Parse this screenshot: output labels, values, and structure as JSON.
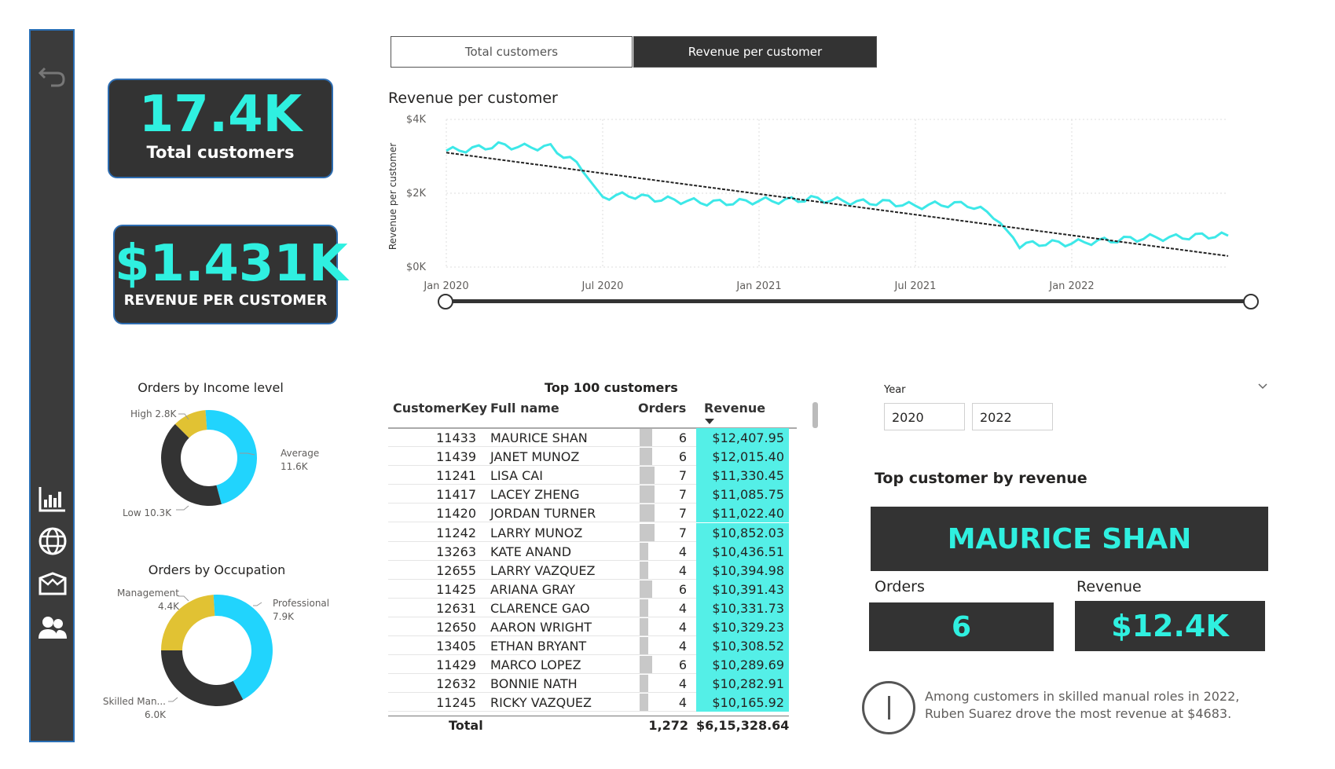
{
  "sidebar": {
    "icons": [
      "back-icon",
      "bar-chart-icon",
      "globe-icon",
      "box-icon",
      "users-icon"
    ]
  },
  "kpis": {
    "total_customers_value": "17.4K",
    "total_customers_label": "Total customers",
    "revenue_per_customer_value": "$1.431K",
    "revenue_per_customer_label": "REVENUE PER CUSTOMER"
  },
  "toggle": {
    "option1": "Total customers",
    "option2": "Revenue per customer",
    "selected": "Revenue per customer"
  },
  "line_chart": {
    "title": "Revenue per customer",
    "ylabel": "Revenue per customer",
    "yticks": [
      "$4K",
      "$2K",
      "$0K"
    ],
    "xticks": [
      "Jan 2020",
      "Jul 2020",
      "Jan 2021",
      "Jul 2021",
      "Jan 2022"
    ]
  },
  "income_donut": {
    "title": "Orders by Income level",
    "labels": [
      {
        "name": "High",
        "value": "2.8K"
      },
      {
        "name": "Average",
        "value": "11.6K"
      },
      {
        "name": "Low",
        "value": "10.3K"
      }
    ]
  },
  "occupation_donut": {
    "title": "Orders by Occupation",
    "labels": [
      {
        "name": "Management",
        "value": "4.4K"
      },
      {
        "name": "Professional",
        "value": "7.9K"
      },
      {
        "name": "Skilled Man...",
        "value": "6.0K"
      }
    ]
  },
  "table": {
    "title": "Top 100 customers",
    "headers": [
      "CustomerKey",
      "Full name",
      "Orders",
      "Revenue"
    ],
    "rows": [
      {
        "key": "11433",
        "name": "MAURICE SHAN",
        "orders": "6",
        "revenue": "$12,407.95"
      },
      {
        "key": "11439",
        "name": "JANET MUNOZ",
        "orders": "6",
        "revenue": "$12,015.40"
      },
      {
        "key": "11241",
        "name": "LISA CAI",
        "orders": "7",
        "revenue": "$11,330.45"
      },
      {
        "key": "11417",
        "name": "LACEY ZHENG",
        "orders": "7",
        "revenue": "$11,085.75"
      },
      {
        "key": "11420",
        "name": "JORDAN TURNER",
        "orders": "7",
        "revenue": "$11,022.40"
      },
      {
        "key": "11242",
        "name": "LARRY MUNOZ",
        "orders": "7",
        "revenue": "$10,852.03"
      },
      {
        "key": "13263",
        "name": "KATE ANAND",
        "orders": "4",
        "revenue": "$10,436.51"
      },
      {
        "key": "12655",
        "name": "LARRY VAZQUEZ",
        "orders": "4",
        "revenue": "$10,394.98"
      },
      {
        "key": "11425",
        "name": "ARIANA GRAY",
        "orders": "6",
        "revenue": "$10,391.43"
      },
      {
        "key": "12631",
        "name": "CLARENCE GAO",
        "orders": "4",
        "revenue": "$10,331.73"
      },
      {
        "key": "12650",
        "name": "AARON WRIGHT",
        "orders": "4",
        "revenue": "$10,329.23"
      },
      {
        "key": "13405",
        "name": "ETHAN BRYANT",
        "orders": "4",
        "revenue": "$10,308.52"
      },
      {
        "key": "11429",
        "name": "MARCO LOPEZ",
        "orders": "6",
        "revenue": "$10,289.69"
      },
      {
        "key": "12632",
        "name": "BONNIE NATH",
        "orders": "4",
        "revenue": "$10,282.91"
      },
      {
        "key": "11245",
        "name": "RICKY VAZQUEZ",
        "orders": "4",
        "revenue": "$10,165.92"
      }
    ],
    "total_label": "Total",
    "total_orders": "1,272",
    "total_revenue": "$6,15,328.64"
  },
  "year_slicer": {
    "label": "Year",
    "from": "2020",
    "to": "2022"
  },
  "top_customer": {
    "title": "Top customer by revenue",
    "name": "MAURICE SHAN",
    "orders_label": "Orders",
    "orders_value": "6",
    "revenue_label": "Revenue",
    "revenue_value": "$12.4K"
  },
  "insight": {
    "icon": "info-icon",
    "text": "Among customers in skilled manual roles in 2022, Ruben Suarez drove the most revenue at $4683."
  },
  "colors": {
    "accent_cyan": "#2ff0e0",
    "line_cyan": "#3de8e8",
    "donut_cyan": "#21d4fd",
    "donut_yellow": "#e1c233",
    "dark": "#333333",
    "border_blue": "#2d6cb0"
  },
  "chart_data": [
    {
      "type": "line",
      "title": "Revenue per customer",
      "xlabel": "",
      "ylabel": "Revenue per customer",
      "ylim": [
        0,
        4000
      ],
      "x_range": [
        "2020-01-01",
        "2022-07-31"
      ],
      "series": [
        {
          "values_monthly": [
            3150,
            3200,
            3300,
            3250,
            3250,
            2800,
            1900,
            1950,
            1850,
            1800,
            1750,
            1750,
            1800,
            1800,
            1850,
            1800,
            1750,
            1750,
            1650,
            1700,
            1700,
            1400,
            600,
            650,
            650,
            700,
            750,
            800,
            800,
            850,
            850
          ]
        },
        {
          "name": "trend",
          "values": [
            3100,
            300
          ]
        }
      ]
    },
    {
      "type": "pie",
      "title": "Orders by Income level",
      "categories": [
        "High",
        "Average",
        "Low"
      ],
      "values": [
        2800,
        11600,
        10300
      ]
    },
    {
      "type": "pie",
      "title": "Orders by Occupation",
      "categories": [
        "Management",
        "Professional",
        "Skilled Man..."
      ],
      "values": [
        4400,
        7900,
        6000
      ]
    }
  ]
}
